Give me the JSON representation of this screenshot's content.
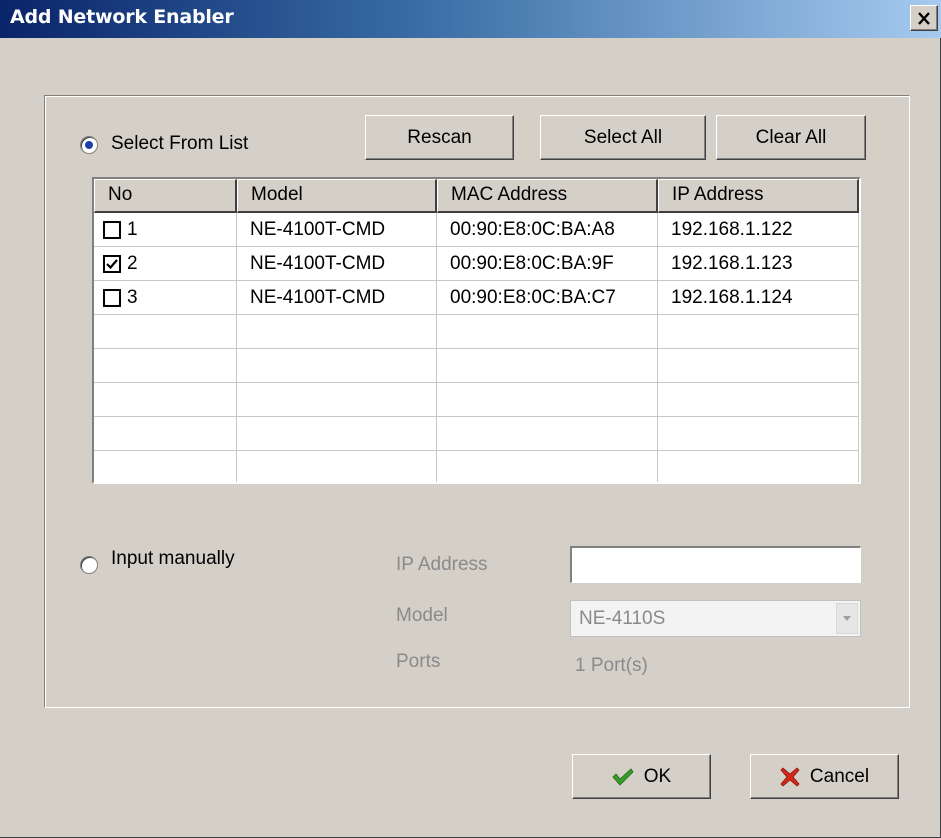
{
  "window": {
    "title": "Add Network Enabler",
    "close_symbol": "×"
  },
  "select_from_list": {
    "label": "Select From List",
    "selected": true
  },
  "buttons": {
    "rescan": "Rescan",
    "select_all": "Select All",
    "clear_all": "Clear All",
    "ok": "OK",
    "cancel": "Cancel"
  },
  "table": {
    "columns": [
      "No",
      "Model",
      "MAC Address",
      "IP Address"
    ],
    "rows": [
      {
        "no": "1",
        "checked": false,
        "model": "NE-4100T-CMD",
        "mac": "00:90:E8:0C:BA:A8",
        "ip": "192.168.1.122"
      },
      {
        "no": "2",
        "checked": true,
        "model": "NE-4100T-CMD",
        "mac": "00:90:E8:0C:BA:9F",
        "ip": "192.168.1.123"
      },
      {
        "no": "3",
        "checked": false,
        "model": "NE-4100T-CMD",
        "mac": "00:90:E8:0C:BA:C7",
        "ip": "192.168.1.124"
      }
    ],
    "empty_rows": 5
  },
  "manual": {
    "label": "Input manually",
    "selected": false,
    "ip_label": "IP Address",
    "ip_value": "",
    "model_label": "Model",
    "model_value": "NE-4110S",
    "ports_label": "Ports",
    "ports_value": "1 Port(s)"
  },
  "icons": {
    "ok": "checkmark-icon",
    "cancel": "red-x-icon",
    "close": "close-icon",
    "dropdown": "chevron-down-icon"
  },
  "colors": {
    "titlebar_start": "#0a246a",
    "titlebar_end": "#a6caf0",
    "ok_check": "#3a9a2a",
    "cancel_x": "#d22a1a",
    "radio_dot": "#1f3fa8"
  }
}
